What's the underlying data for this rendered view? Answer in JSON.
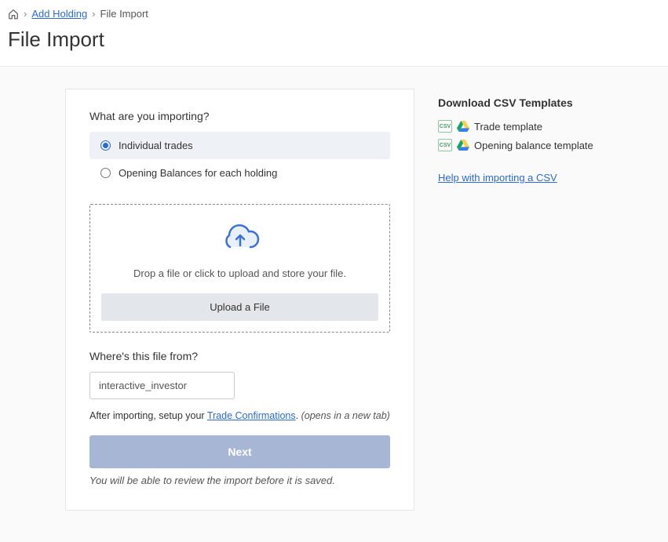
{
  "breadcrumb": {
    "home_label": "Home",
    "link1": "Add Holding",
    "current": "File Import"
  },
  "page_title": "File Import",
  "card": {
    "question": "What are you importing?",
    "options": [
      {
        "label": "Individual trades",
        "selected": true
      },
      {
        "label": "Opening Balances for each holding",
        "selected": false
      }
    ],
    "dropzone_text": "Drop a file or click to upload and store your file.",
    "upload_button": "Upload a File",
    "source_label": "Where's this file from?",
    "source_value": "interactive_investor",
    "hint_prefix": "After importing, setup your ",
    "hint_link": "Trade Confirmations",
    "hint_suffix": ". ",
    "hint_note": "(opens in a new tab)",
    "next_button": "Next",
    "review_note": "You will be able to review the import before it is saved."
  },
  "side": {
    "title": "Download CSV Templates",
    "templates": [
      {
        "label": "Trade template"
      },
      {
        "label": "Opening balance template"
      }
    ],
    "help_link": "Help with importing a CSV",
    "csv_badge": "CSV"
  }
}
